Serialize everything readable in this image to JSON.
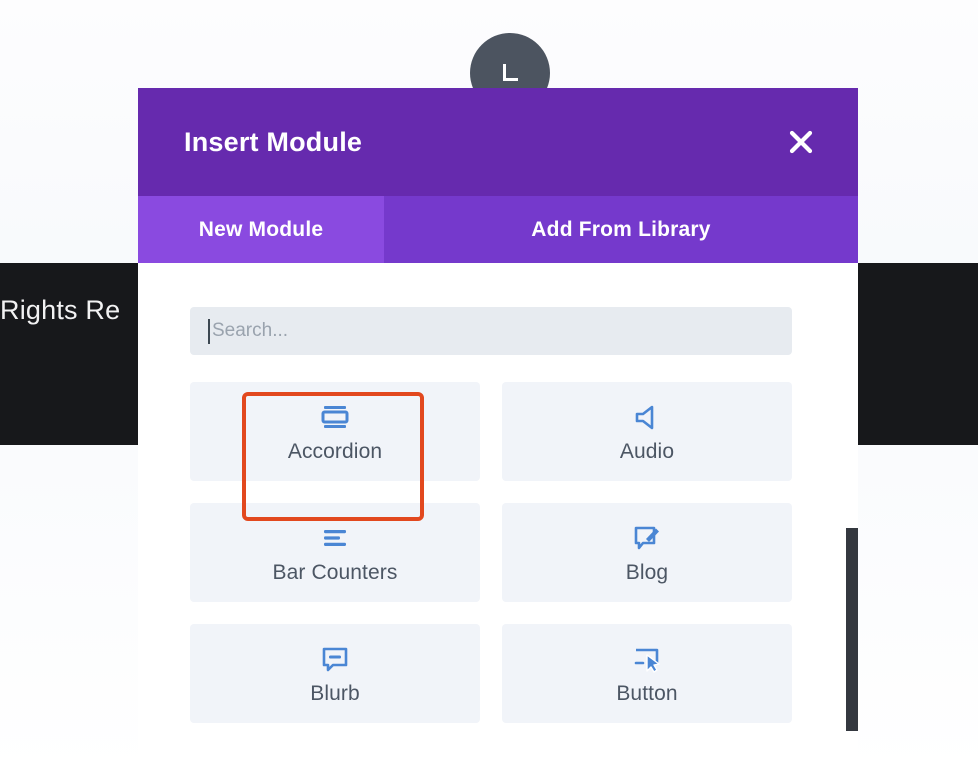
{
  "background": {
    "footer_text": "Rights Re"
  },
  "top_button": {
    "icon": "insert-module-icon"
  },
  "modal": {
    "title": "Insert Module",
    "close_label": "close-icon",
    "accent_purple": "#662aae",
    "tab_active_color": "#8a4ae0",
    "tab_inactive_color": "#7539cc",
    "highlight_color": "#e2481e",
    "tabs": [
      {
        "label": "New Module",
        "active": true
      },
      {
        "label": "Add From Library",
        "active": false
      }
    ],
    "search": {
      "value": "",
      "placeholder": "Search..."
    },
    "modules": [
      {
        "label": "Accordion",
        "icon": "accordion-icon",
        "highlighted": true
      },
      {
        "label": "Audio",
        "icon": "speaker-icon",
        "highlighted": false
      },
      {
        "label": "Bar Counters",
        "icon": "bars-icon",
        "highlighted": false
      },
      {
        "label": "Blog",
        "icon": "blog-pencil-icon",
        "highlighted": false
      },
      {
        "label": "Blurb",
        "icon": "blurb-bubble-icon",
        "highlighted": false
      },
      {
        "label": "Button",
        "icon": "button-cursor-icon",
        "highlighted": false
      }
    ]
  }
}
